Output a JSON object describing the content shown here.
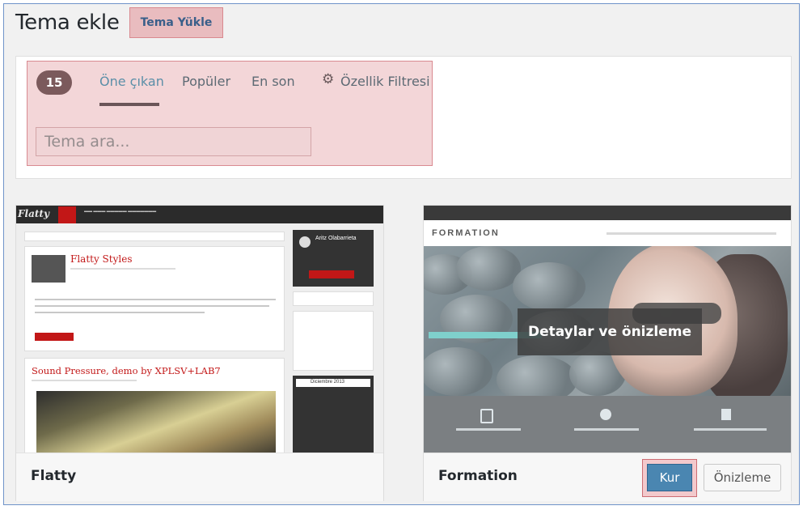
{
  "header": {
    "title": "Tema ekle",
    "upload_label": "Tema Yükle"
  },
  "filter": {
    "count": "15",
    "tabs": [
      {
        "label": "Öne çıkan",
        "active": true
      },
      {
        "label": "Popüler",
        "active": false
      },
      {
        "label": "En son",
        "active": false
      }
    ],
    "feature_filter_label": "Özellik Filtresi",
    "feature_filter_icon": "gear-icon",
    "search_placeholder": "Tema ara..."
  },
  "themes": [
    {
      "name": "Flatty",
      "screenshot": {
        "logo": "Flatty",
        "post1_title": "Flatty Styles",
        "post2_title": "Sound Pressure, demo by XPLSV+LAB7",
        "author": "Aritz Olabarrieta",
        "calendar_title": "Diciembre 2013"
      }
    },
    {
      "name": "Formation",
      "screenshot": {
        "logo": "FORMATION"
      },
      "overlay_label": "Detaylar ve önizleme",
      "install_label": "Kur",
      "preview_label": "Önizleme"
    }
  ],
  "colors": {
    "install_button": "#4a86b1",
    "highlight": "#e9bcbf",
    "active_tab": "#5b8fa8",
    "count_badge": "#7b5a5c"
  }
}
